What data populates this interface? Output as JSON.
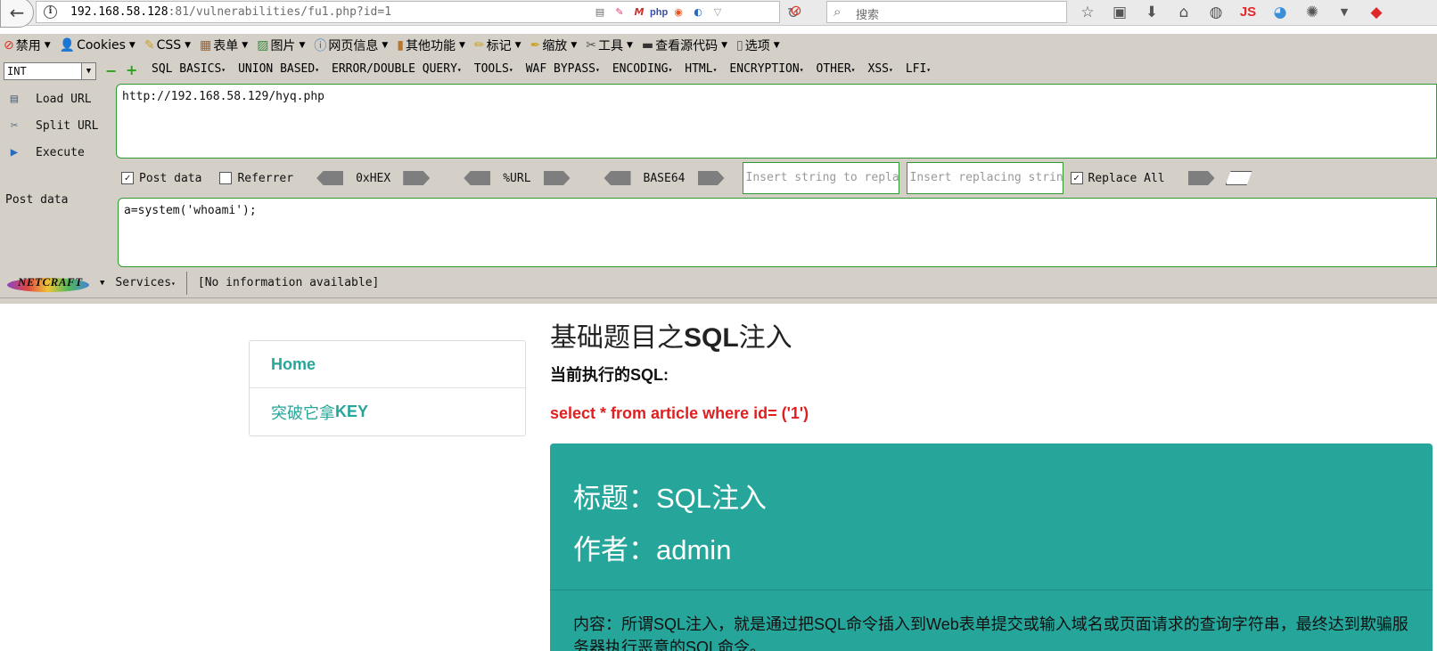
{
  "browser": {
    "url_host": "192.168.58.128",
    "url_rest": ":81/vulnerabilities/fu1.php?id=1",
    "search_placeholder": "搜索",
    "php_icon_text": "php",
    "js_icon_text": "JS"
  },
  "menubar": {
    "items": [
      "禁用",
      "Cookies",
      "CSS",
      "表单",
      "图片",
      "网页信息",
      "其他功能",
      "标记",
      "缩放",
      "工具",
      "查看源代码",
      "选项"
    ]
  },
  "hackbar": {
    "type_select": "INT",
    "menus": [
      "SQL BASICS",
      "UNION BASED",
      "ERROR/DOUBLE QUERY",
      "TOOLS",
      "WAF BYPASS",
      "ENCODING",
      "HTML",
      "ENCRYPTION",
      "OTHER",
      "XSS",
      "LFI"
    ],
    "actions": [
      "Load URL",
      "Split URL",
      "Execute"
    ],
    "url_value": "http://192.168.58.129/hyq.php",
    "post_data_label": "Post data",
    "post_data_checked": true,
    "referrer_label": "Referrer",
    "referrer_checked": false,
    "encodings": [
      "0xHEX",
      "%URL",
      "BASE64"
    ],
    "insert_placeholder": "Insert string to replace",
    "replacing_placeholder": "Insert replacing string",
    "replace_all_label": "Replace All",
    "replace_all_checked": true,
    "post_label": "Post data",
    "post_value": "a=system('whoami');"
  },
  "netcraft": {
    "logo_text": "NETCRAFT",
    "services": "Services",
    "info": "[No information available]"
  },
  "page": {
    "nav": {
      "home": "Home",
      "key_prefix": "突破它拿",
      "key_suffix": "KEY"
    },
    "title_prefix": "基础题目之",
    "title_bold": "SQL",
    "title_suffix": "注入",
    "sql_label": "当前执行的SQL:",
    "sql_query": "select * from article where id= ('1')",
    "card": {
      "title": "标题：SQL注入",
      "author": "作者：admin",
      "content": "内容：所谓SQL注入，就是通过把SQL命令插入到Web表单提交或输入域名或页面请求的查询字符串，最终达到欺骗服务器执行恶意的SQL命令。"
    }
  },
  "colors": {
    "accent": "#26a69a",
    "sql_red": "#e02020",
    "hackbar_bg": "#d4d0c8",
    "field_border": "#2f9a2f"
  }
}
